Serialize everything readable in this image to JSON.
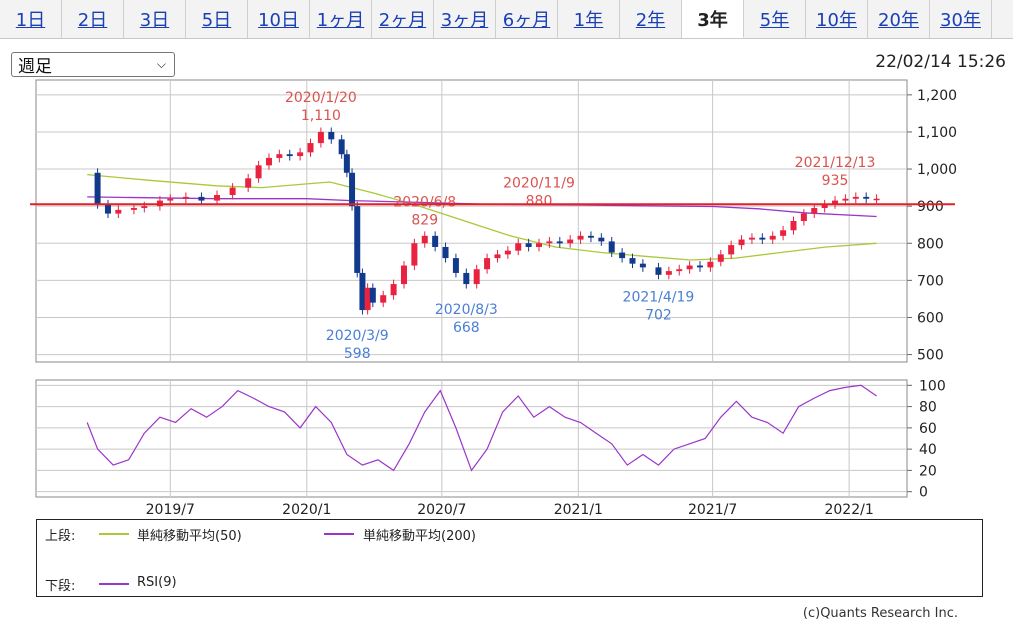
{
  "tabs": [
    {
      "label": "1日",
      "active": false
    },
    {
      "label": "2日",
      "active": false
    },
    {
      "label": "3日",
      "active": false
    },
    {
      "label": "5日",
      "active": false
    },
    {
      "label": "10日",
      "active": false
    },
    {
      "label": "1ヶ月",
      "active": false
    },
    {
      "label": "2ヶ月",
      "active": false
    },
    {
      "label": "3ヶ月",
      "active": false
    },
    {
      "label": "6ヶ月",
      "active": false
    },
    {
      "label": "1年",
      "active": false
    },
    {
      "label": "2年",
      "active": false
    },
    {
      "label": "3年",
      "active": true
    },
    {
      "label": "5年",
      "active": false
    },
    {
      "label": "10年",
      "active": false
    },
    {
      "label": "20年",
      "active": false
    },
    {
      "label": "30年",
      "active": false
    }
  ],
  "period_select": {
    "value": "週足"
  },
  "timestamp": "22/02/14 15:26",
  "legend": {
    "upper_label": "上段:",
    "lower_label": "下段:",
    "sma50": "単純移動平均(50)",
    "sma200": "単純移動平均(200)",
    "rsi": "RSI(9)"
  },
  "copyright": "(c)Quants Research Inc.",
  "colors": {
    "up": "#e8223f",
    "down": "#123a8c",
    "sma50": "#a9c93a",
    "sma200": "#9a35c9",
    "rsi": "#9a35c9",
    "hline": "#e2202a",
    "annot_high": "#d9534f",
    "annot_low": "#4a7fd6"
  },
  "chart_data": [
    {
      "type": "candlestick",
      "x_ticks": [
        {
          "date": "2019-07-01",
          "label": "2019/7"
        },
        {
          "date": "2020-01-01",
          "label": "2020/1"
        },
        {
          "date": "2020-07-01",
          "label": "2020/7"
        },
        {
          "date": "2021-01-01",
          "label": "2021/1"
        },
        {
          "date": "2021-07-01",
          "label": "2021/7"
        },
        {
          "date": "2022-01-01",
          "label": "2022/1"
        }
      ],
      "x_range": [
        "2019-01-01",
        "2022-03-20"
      ],
      "ylim": [
        480,
        1240
      ],
      "y_ticks": [
        500,
        600,
        700,
        800,
        900,
        1000,
        1100,
        1200
      ],
      "y_tick_labels": [
        "500",
        "600",
        "700",
        "800",
        "900",
        "1,000",
        "1,100",
        "1,200"
      ],
      "horizontal_line": 905,
      "close_series": [
        [
          "2019-03-11",
          990
        ],
        [
          "2019-03-25",
          905
        ],
        [
          "2019-04-08",
          880
        ],
        [
          "2019-04-22",
          890
        ],
        [
          "2019-05-13",
          895
        ],
        [
          "2019-05-27",
          900
        ],
        [
          "2019-06-17",
          915
        ],
        [
          "2019-07-01",
          920
        ],
        [
          "2019-07-22",
          925
        ],
        [
          "2019-08-12",
          915
        ],
        [
          "2019-09-02",
          930
        ],
        [
          "2019-09-23",
          950
        ],
        [
          "2019-10-14",
          975
        ],
        [
          "2019-10-28",
          1010
        ],
        [
          "2019-11-11",
          1030
        ],
        [
          "2019-11-25",
          1040
        ],
        [
          "2019-12-09",
          1035
        ],
        [
          "2019-12-23",
          1045
        ],
        [
          "2020-01-06",
          1070
        ],
        [
          "2020-01-20",
          1100
        ],
        [
          "2020-02-03",
          1080
        ],
        [
          "2020-02-17",
          1040
        ],
        [
          "2020-02-24",
          990
        ],
        [
          "2020-03-02",
          900
        ],
        [
          "2020-03-09",
          720
        ],
        [
          "2020-03-16",
          620
        ],
        [
          "2020-03-23",
          680
        ],
        [
          "2020-03-30",
          640
        ],
        [
          "2020-04-13",
          660
        ],
        [
          "2020-04-27",
          690
        ],
        [
          "2020-05-11",
          740
        ],
        [
          "2020-05-25",
          800
        ],
        [
          "2020-06-08",
          820
        ],
        [
          "2020-06-22",
          790
        ],
        [
          "2020-07-06",
          760
        ],
        [
          "2020-07-20",
          720
        ],
        [
          "2020-08-03",
          690
        ],
        [
          "2020-08-17",
          730
        ],
        [
          "2020-08-31",
          760
        ],
        [
          "2020-09-14",
          770
        ],
        [
          "2020-09-28",
          780
        ],
        [
          "2020-10-12",
          800
        ],
        [
          "2020-10-26",
          790
        ],
        [
          "2020-11-09",
          800
        ],
        [
          "2020-11-23",
          805
        ],
        [
          "2020-12-07",
          800
        ],
        [
          "2020-12-21",
          810
        ],
        [
          "2021-01-04",
          820
        ],
        [
          "2021-01-18",
          815
        ],
        [
          "2021-02-01",
          805
        ],
        [
          "2021-02-15",
          775
        ],
        [
          "2021-03-01",
          760
        ],
        [
          "2021-03-15",
          745
        ],
        [
          "2021-03-29",
          735
        ],
        [
          "2021-04-19",
          715
        ],
        [
          "2021-05-03",
          725
        ],
        [
          "2021-05-17",
          730
        ],
        [
          "2021-05-31",
          740
        ],
        [
          "2021-06-14",
          735
        ],
        [
          "2021-06-28",
          750
        ],
        [
          "2021-07-12",
          770
        ],
        [
          "2021-07-26",
          795
        ],
        [
          "2021-08-09",
          810
        ],
        [
          "2021-08-23",
          815
        ],
        [
          "2021-09-06",
          810
        ],
        [
          "2021-09-20",
          820
        ],
        [
          "2021-10-04",
          835
        ],
        [
          "2021-10-18",
          860
        ],
        [
          "2021-11-01",
          880
        ],
        [
          "2021-11-15",
          895
        ],
        [
          "2021-11-29",
          905
        ],
        [
          "2021-12-13",
          915
        ],
        [
          "2021-12-27",
          920
        ],
        [
          "2022-01-10",
          925
        ],
        [
          "2022-01-24",
          920
        ],
        [
          "2022-02-07",
          920
        ]
      ],
      "sma50": [
        [
          "2019-03-11",
          985
        ],
        [
          "2019-06-01",
          970
        ],
        [
          "2019-09-01",
          955
        ],
        [
          "2019-11-01",
          950
        ],
        [
          "2020-01-01",
          960
        ],
        [
          "2020-02-01",
          965
        ],
        [
          "2020-04-01",
          935
        ],
        [
          "2020-06-01",
          900
        ],
        [
          "2020-08-01",
          860
        ],
        [
          "2020-10-01",
          820
        ],
        [
          "2020-12-01",
          790
        ],
        [
          "2021-02-01",
          775
        ],
        [
          "2021-04-01",
          765
        ],
        [
          "2021-06-01",
          755
        ],
        [
          "2021-08-01",
          760
        ],
        [
          "2021-10-01",
          775
        ],
        [
          "2021-12-01",
          790
        ],
        [
          "2022-02-07",
          800
        ]
      ],
      "sma200": [
        [
          "2019-03-11",
          925
        ],
        [
          "2019-09-01",
          920
        ],
        [
          "2020-01-01",
          920
        ],
        [
          "2020-03-01",
          915
        ],
        [
          "2020-06-01",
          910
        ],
        [
          "2020-09-01",
          905
        ],
        [
          "2021-01-01",
          903
        ],
        [
          "2021-04-01",
          901
        ],
        [
          "2021-07-01",
          899
        ],
        [
          "2021-09-01",
          893
        ],
        [
          "2021-11-01",
          882
        ],
        [
          "2022-02-07",
          872
        ]
      ],
      "annotations": [
        {
          "kind": "high",
          "date": "2020-01-20",
          "value": 1110,
          "date_label": "2020/1/20",
          "value_label": "1,110"
        },
        {
          "kind": "high",
          "date": "2020-06-08",
          "value": 829,
          "date_label": "2020/6/8",
          "value_label": "829"
        },
        {
          "kind": "high",
          "date": "2020-11-09",
          "value": 880,
          "date_label": "2020/11/9",
          "value_label": "880"
        },
        {
          "kind": "high",
          "date": "2021-12-13",
          "value": 935,
          "date_label": "2021/12/13",
          "value_label": "935"
        },
        {
          "kind": "low",
          "date": "2020-03-09",
          "value": 598,
          "date_label": "2020/3/9",
          "value_label": "598"
        },
        {
          "kind": "low",
          "date": "2020-08-03",
          "value": 668,
          "date_label": "2020/8/3",
          "value_label": "668"
        },
        {
          "kind": "low",
          "date": "2021-04-19",
          "value": 702,
          "date_label": "2021/4/19",
          "value_label": "702"
        }
      ]
    },
    {
      "type": "line",
      "name": "RSI(9)",
      "ylim": [
        -5,
        105
      ],
      "y_ticks": [
        0,
        20,
        40,
        60,
        80,
        100
      ],
      "y_tick_labels": [
        "0",
        "20",
        "40",
        "60",
        "80",
        "100"
      ],
      "series": [
        [
          "2019-03-11",
          65
        ],
        [
          "2019-03-25",
          40
        ],
        [
          "2019-04-15",
          25
        ],
        [
          "2019-05-06",
          30
        ],
        [
          "2019-05-27",
          55
        ],
        [
          "2019-06-17",
          70
        ],
        [
          "2019-07-08",
          65
        ],
        [
          "2019-07-29",
          78
        ],
        [
          "2019-08-19",
          70
        ],
        [
          "2019-09-09",
          80
        ],
        [
          "2019-09-30",
          95
        ],
        [
          "2019-10-21",
          88
        ],
        [
          "2019-11-11",
          80
        ],
        [
          "2019-12-02",
          75
        ],
        [
          "2019-12-23",
          60
        ],
        [
          "2020-01-13",
          80
        ],
        [
          "2020-02-03",
          65
        ],
        [
          "2020-02-24",
          35
        ],
        [
          "2020-03-16",
          25
        ],
        [
          "2020-04-06",
          30
        ],
        [
          "2020-04-27",
          20
        ],
        [
          "2020-05-18",
          45
        ],
        [
          "2020-06-08",
          75
        ],
        [
          "2020-06-29",
          95
        ],
        [
          "2020-07-20",
          60
        ],
        [
          "2020-08-10",
          20
        ],
        [
          "2020-08-31",
          40
        ],
        [
          "2020-09-21",
          75
        ],
        [
          "2020-10-12",
          90
        ],
        [
          "2020-11-02",
          70
        ],
        [
          "2020-11-23",
          80
        ],
        [
          "2020-12-14",
          70
        ],
        [
          "2021-01-04",
          65
        ],
        [
          "2021-01-25",
          55
        ],
        [
          "2021-02-15",
          45
        ],
        [
          "2021-03-08",
          25
        ],
        [
          "2021-03-29",
          35
        ],
        [
          "2021-04-19",
          25
        ],
        [
          "2021-05-10",
          40
        ],
        [
          "2021-05-31",
          45
        ],
        [
          "2021-06-21",
          50
        ],
        [
          "2021-07-12",
          70
        ],
        [
          "2021-08-02",
          85
        ],
        [
          "2021-08-23",
          70
        ],
        [
          "2021-09-13",
          65
        ],
        [
          "2021-10-04",
          55
        ],
        [
          "2021-10-25",
          80
        ],
        [
          "2021-11-15",
          88
        ],
        [
          "2021-12-06",
          95
        ],
        [
          "2021-12-27",
          98
        ],
        [
          "2022-01-17",
          100
        ],
        [
          "2022-02-07",
          90
        ]
      ]
    }
  ]
}
